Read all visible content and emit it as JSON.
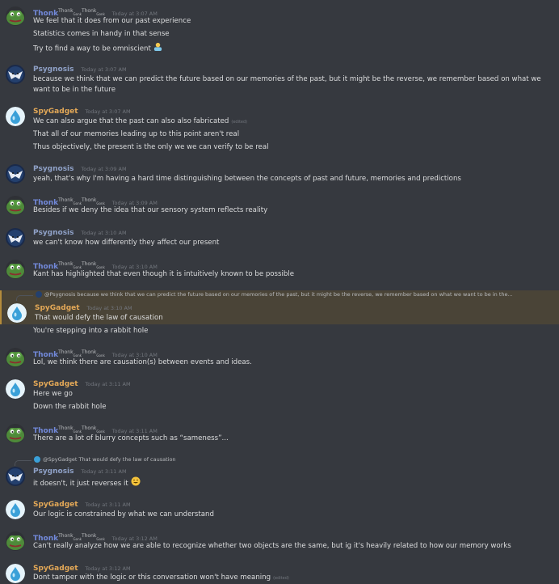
{
  "users": {
    "thonk": {
      "name": "Thonk",
      "sup1": "Thonk",
      "sub1": "Gonk",
      "sup2": "Thonk",
      "sub2": "Gonk"
    },
    "psy": {
      "name": "Psygnosis"
    },
    "spy": {
      "name": "SpyGadget"
    }
  },
  "edited_label": "(edited)",
  "messages": [
    {
      "author": "Thonk",
      "time": "Today at 3:07 AM",
      "lines": [
        "We feel that it does from our past experience",
        "Statistics comes in handy in that sense",
        "Try to find a way to be omniscient"
      ]
    },
    {
      "author": "Psygnosis",
      "time": "Today at 3:07 AM",
      "lines": [
        "because we think that we can predict the future based on our memories of the past, but it might be the reverse, we remember based on what we want to be in the future"
      ]
    },
    {
      "author": "SpyGadget",
      "time": "Today at 3:07 AM",
      "lines": [
        "We can also argue that the past can also also fabricated",
        "That all of our memories leading up to this point aren't real",
        "Thus objectively, the present is the only we we can verify to be real"
      ]
    },
    {
      "author": "Psygnosis",
      "time": "Today at 3:09 AM",
      "lines": [
        "yeah, that's why I'm having a hard time distinguishing between the concepts of past and future, memories and predictions"
      ]
    },
    {
      "author": "Thonk",
      "time": "Today at 3:09 AM",
      "lines": [
        "Besides if we deny the idea that our sensory system reflects reality"
      ]
    },
    {
      "author": "Psygnosis",
      "time": "Today at 3:10 AM",
      "lines": [
        "we can't know how differently they affect our present"
      ]
    },
    {
      "author": "Thonk",
      "time": "Today at 3:10 AM",
      "lines": [
        "Kant has highlighted that even though it is intuitively known to be possible"
      ]
    },
    {
      "author": "SpyGadget",
      "time": "Today at 3:10 AM",
      "reply": {
        "mention": "@Psygnosis",
        "text": "because we think that we can predict the future based on our memories of the past, but it might be the reverse, we remember based on what we want to be in the..."
      },
      "lines": [
        "That would defy the law of causation",
        "You're stepping into a rabbit hole"
      ]
    },
    {
      "author": "Thonk",
      "time": "Today at 3:10 AM",
      "lines": [
        "Lol, we think there are causation(s) between events and ideas."
      ]
    },
    {
      "author": "SpyGadget",
      "time": "Today at 3:11 AM",
      "lines": [
        "Here we go",
        "Down the rabbit hole"
      ]
    },
    {
      "author": "Thonk",
      "time": "Today at 3:11 AM",
      "lines": [
        "There are a lot of blurry concepts such as “sameness”..."
      ]
    },
    {
      "author": "Psygnosis",
      "time": "Today at 3:11 AM",
      "reply": {
        "mention": "@SpyGadget",
        "text": "That would defy the law of causation"
      },
      "lines": [
        "it doesn't, it just reverses it"
      ]
    },
    {
      "author": "SpyGadget",
      "time": "Today at 3:11 AM",
      "lines": [
        "Our logic is constrained by what we can understand"
      ]
    },
    {
      "author": "Thonk",
      "time": "Today at 3:12 AM",
      "lines": [
        "Can't really analyze how we are able to recognize whether two objects are the same, but ig it's heavily related to how our memory works"
      ]
    },
    {
      "author": "SpyGadget",
      "time": "Today at 3:12 AM",
      "lines": [
        "Dont tamper with the logic or this conversation won't have meaning"
      ]
    }
  ]
}
